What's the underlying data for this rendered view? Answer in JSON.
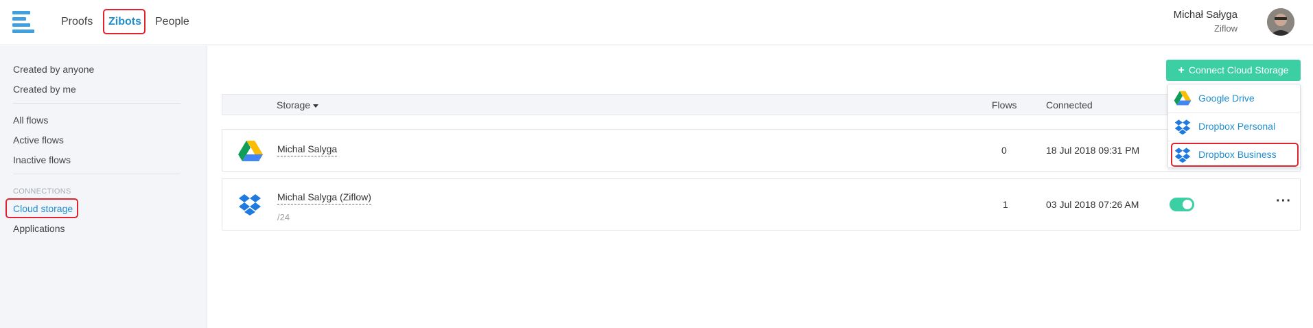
{
  "header": {
    "nav": [
      {
        "label": "Proofs"
      },
      {
        "label": "Zibots",
        "active": true
      },
      {
        "label": "People"
      }
    ],
    "user": {
      "name": "Michał Sałyga",
      "org": "Ziflow"
    }
  },
  "sidebar": {
    "filters": [
      "Created by anyone",
      "Created by me"
    ],
    "flows": [
      "All flows",
      "Active flows",
      "Inactive flows"
    ],
    "section_title": "CONNECTIONS",
    "connections": [
      {
        "label": "Cloud storage",
        "active": true
      },
      {
        "label": "Applications"
      }
    ]
  },
  "toolbar": {
    "connect_label": "Connect Cloud Storage",
    "connect_icon": "plus-icon"
  },
  "dropdown": {
    "items": [
      {
        "label": "Google Drive",
        "icon": "google-drive-icon"
      },
      {
        "label": "Dropbox Personal",
        "icon": "dropbox-icon"
      },
      {
        "label": "Dropbox Business",
        "icon": "dropbox-icon",
        "highlighted": true
      }
    ]
  },
  "table": {
    "columns": {
      "storage": "Storage",
      "flows": "Flows",
      "connected": "Connected"
    },
    "rows": [
      {
        "icon": "google-drive-icon",
        "name": "Michal Salyga",
        "sub": "",
        "flows": "0",
        "connected": "18 Jul 2018 09:31 PM"
      },
      {
        "icon": "dropbox-icon",
        "name": "Michal Salyga (Ziflow)",
        "sub": "/24",
        "flows": "1",
        "connected": "03 Jul 2018 07:26 AM",
        "enabled": true
      }
    ]
  },
  "colors": {
    "accent": "#3ccfa3",
    "link": "#1f8fd0",
    "highlight": "#e0242f"
  }
}
